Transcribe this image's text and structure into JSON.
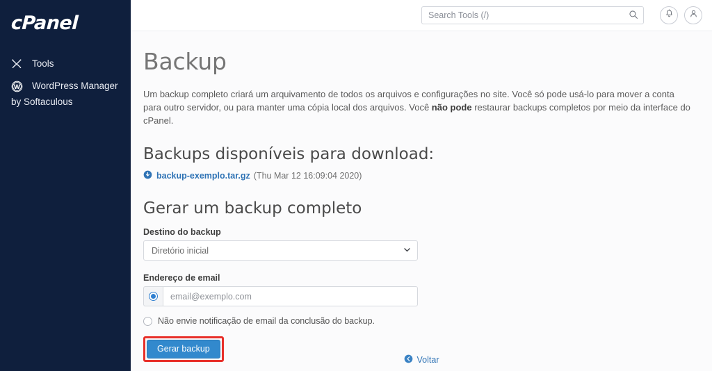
{
  "sidebar": {
    "logo": "cPanel",
    "items": [
      {
        "label": "Tools",
        "icon": "tools-icon"
      },
      {
        "label": "WordPress Manager",
        "icon": "wordpress-icon",
        "subtitle": "by Softaculous"
      }
    ]
  },
  "topbar": {
    "search_placeholder": "Search Tools (/)",
    "search_value": "",
    "search_icon": "search-icon",
    "notifications_icon": "bell-icon",
    "user_icon": "user-icon"
  },
  "page": {
    "title": "Backup",
    "intro": "Um backup completo criará um arquivamento de todos os arquivos e configurações no site. Você só pode usá-lo para mover a conta para outro servidor, ou para manter uma cópia local dos arquivos. Você ",
    "intro_bold": "não pode",
    "intro_tail": " restaurar backups completos por meio da interface do cPanel."
  },
  "downloads": {
    "heading": "Backups disponíveis para download:",
    "items": [
      {
        "icon": "download-circle-icon",
        "filename": "backup-exemplo.tar.gz",
        "date": "(Thu Mar 12 16:09:04 2020)"
      }
    ]
  },
  "generate": {
    "heading": "Gerar um backup completo",
    "destination_label": "Destino do backup",
    "destination_value": "Diretório inicial",
    "destination_options": [
      "Diretório inicial"
    ],
    "destination_icon": "chevron-down-icon",
    "email_label": "Endereço de email",
    "email_placeholder": "email@exemplo.com",
    "email_value": "",
    "email_radio_checked": true,
    "no_email_label": "Não envie notificação de email da conclusão do backup.",
    "no_email_radio_checked": false,
    "submit_label": "Gerar backup",
    "submit_highlight_color": "#e8302a",
    "submit_color": "#3289cd"
  },
  "footer": {
    "back_label": "Voltar",
    "back_icon": "arrow-left-circle-icon"
  },
  "colors": {
    "sidebar_bg": "#0f1f3d",
    "link": "#2f73b5",
    "accent": "#3289cd"
  }
}
